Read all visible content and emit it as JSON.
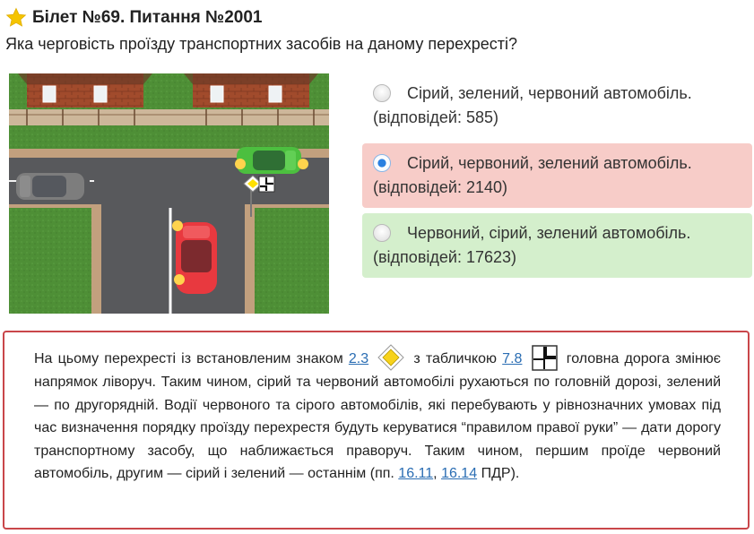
{
  "header": {
    "title": "Білет №69. Питання №2001",
    "question": "Яка черговість проїзду транспортних засобів на даному перехресті?"
  },
  "options": [
    {
      "text": "Сірий, зелений, червоний автомобіль.",
      "count": "(відповідей: 585)",
      "state": "neutral",
      "selected": false
    },
    {
      "text": "Сірий, червоний, зелений автомобіль.",
      "count": "(відповідей: 2140)",
      "state": "wrong",
      "selected": true
    },
    {
      "text": "Червоний, сірий, зелений автомобіль.",
      "count": "(відповідей: 17623)",
      "state": "correct",
      "selected": false
    }
  ],
  "explanation": {
    "p1": "На цьому перехресті із встановленим знаком",
    "sign_link": "2.3",
    "p2": "з табличкою",
    "plate_link": "7.8",
    "p3": "головна дорога змінює напрямок ліворуч. Таким чином, сірий та червоний автомобілі рухаються по головній дорозі, зелений — по другорядній. Водії червоного та сірого автомобілів, які перебувають у рівнозначних умовах під час визначення порядку проїзду перехрестя будуть керуватися “правилом правої руки” — дати дорогу транспортному засобу, що наближається праворуч. Таким чином, першим проїде червоний автомобіль, другим — сірий і зелений — останнім (пп.",
    "link1": "16.11",
    "sep": ",",
    "link2": "16.14",
    "p4": "ПДР)."
  },
  "colors": {
    "wrong_bg": "#f7ccc8",
    "correct_bg": "#d4efcc",
    "border": "#c9464a",
    "link": "#2a6db3",
    "star": "#f5c400"
  },
  "icons": {
    "favorite": "star-icon",
    "sign": "priority-road-sign-icon",
    "plate": "main-road-direction-plate-icon"
  }
}
